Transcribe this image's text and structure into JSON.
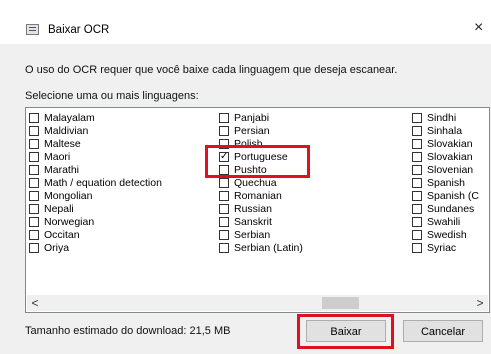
{
  "window": {
    "title": "Baixar OCR",
    "close_glyph": "×"
  },
  "instructions": "O uso do OCR requer que você baixe cada linguagem que deseja escanear.",
  "select_label": "Selecione uma ou mais linguagens:",
  "languages": {
    "col1": [
      "Malayalam",
      "Maldivian",
      "Maltese",
      "Maori",
      "Marathi",
      "Math / equation detection",
      "Mongolian",
      "Nepali",
      "Norwegian",
      "Occitan",
      "Oriya"
    ],
    "col2": [
      "Panjabi",
      "Persian",
      "Polish",
      "Portuguese",
      "Pushto",
      "Quechua",
      "Romanian",
      "Russian",
      "Sanskrit",
      "Serbian",
      "Serbian (Latin)"
    ],
    "col3": [
      "Sindhi",
      "Sinhala",
      "Slovakian",
      "Slovakian",
      "Slovenian",
      "Spanish",
      "Spanish (C",
      "Sundanes",
      "Swahili",
      "Swedish",
      "Syriac"
    ],
    "checked": "Portuguese"
  },
  "scrollbar": {
    "left_arrow": "<",
    "right_arrow": ">"
  },
  "footer": {
    "download_size": "Tamanho estimado do download: 21,5 MB",
    "download_button": "Baixar",
    "cancel_button": "Cancelar"
  },
  "annotation_color": "#e0101e"
}
